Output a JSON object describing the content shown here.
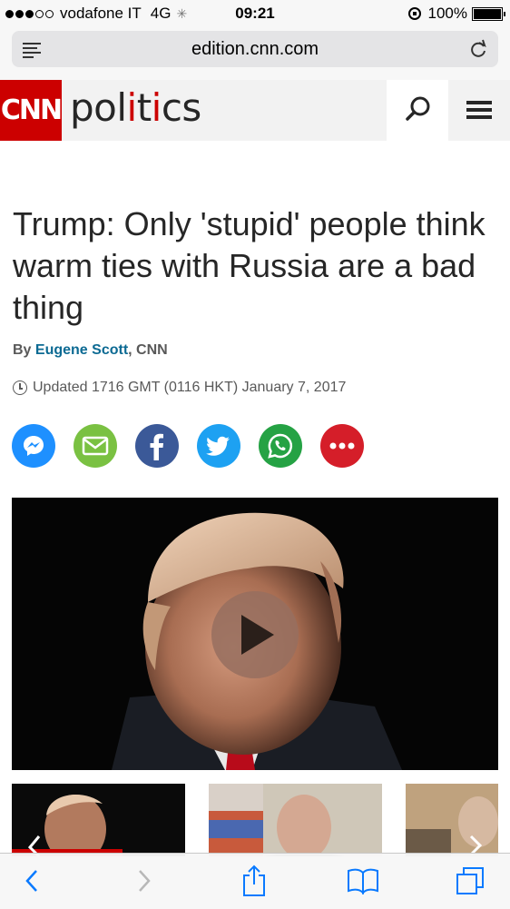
{
  "status_bar": {
    "carrier": "vodafone IT",
    "network": "4G",
    "time": "09:21",
    "battery": "100%"
  },
  "browser": {
    "url": "edition.cnn.com",
    "reader_icon": "reader-view-icon",
    "reload_icon": "reload-icon"
  },
  "site_header": {
    "logo": "CNN",
    "section_prefix": "pol",
    "section_accent": "i",
    "section_middle": "t",
    "section_accent2": "i",
    "section_suffix": "cs",
    "brand_color": "#cc0000",
    "search_icon": "search-icon",
    "menu_icon": "hamburger-menu-icon"
  },
  "article": {
    "headline": "Trump: Only 'stupid' people think warm ties with Russia are a bad thing",
    "byline_prefix": "By ",
    "author": "Eugene Scott",
    "byline_suffix": ", CNN",
    "updated": "Updated 1716 GMT (0116 HKT) January 7, 2017",
    "share_icons": [
      "messenger-icon",
      "email-icon",
      "facebook-icon",
      "twitter-icon",
      "whatsapp-icon",
      "more-icon"
    ]
  },
  "video": {
    "play_icon": "play-icon"
  },
  "toolbar": {
    "icons": [
      "back-icon",
      "forward-icon",
      "share-icon",
      "bookmarks-icon",
      "tabs-icon"
    ]
  }
}
